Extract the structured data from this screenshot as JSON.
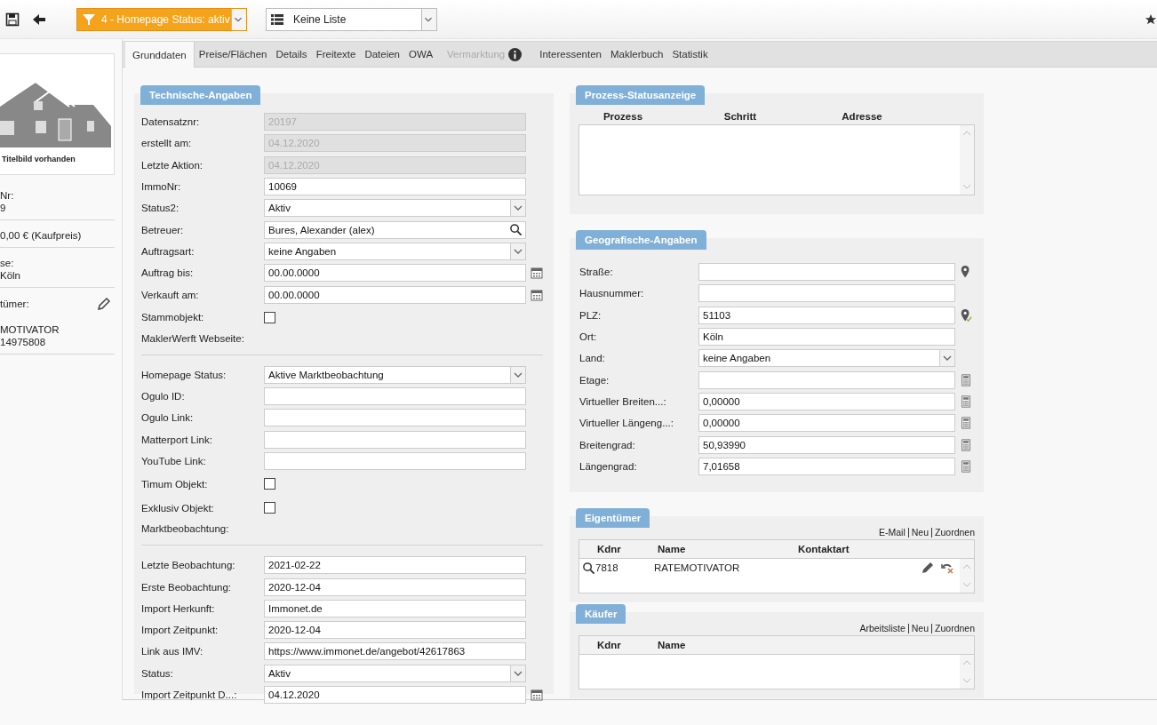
{
  "toolbar": {
    "filter": "4 - Homepage Status: aktiv",
    "list": "Keine Liste"
  },
  "sidebar": {
    "image_caption": "Titelbild vorhanden",
    "items": [
      {
        "label": "Nr:",
        "value": "9",
        "editable": false
      },
      {
        "value": "0,00 € (Kaufpreis)",
        "editable": false
      },
      {
        "label": "se:",
        "value": "Köln",
        "editable": false
      },
      {
        "label": "tümer:",
        "value": "MOTIVATOR",
        "extra": "14975808",
        "editable": true
      }
    ]
  },
  "tabs": [
    {
      "label": "Grunddaten",
      "selected": true,
      "disabled": false
    },
    {
      "label": "Preise/Flächen",
      "selected": false,
      "disabled": false
    },
    {
      "label": "Details",
      "selected": false,
      "disabled": false
    },
    {
      "label": "Freitexte",
      "selected": false,
      "disabled": false
    },
    {
      "label": "Dateien",
      "selected": false,
      "disabled": false
    },
    {
      "label": "OWA",
      "selected": false,
      "disabled": false
    },
    {
      "label": "Vermarktung",
      "selected": false,
      "disabled": true,
      "info": true
    },
    {
      "label": "Interessenten",
      "selected": false,
      "disabled": false
    },
    {
      "label": "Maklerbuch",
      "selected": false,
      "disabled": false
    },
    {
      "label": "Statistik",
      "selected": false,
      "disabled": false
    }
  ],
  "technical": {
    "title": "Technische-Angaben",
    "groups": [
      [
        {
          "label": "Datensatznr:",
          "kind": "text",
          "value": "20197",
          "disabled": true
        },
        {
          "label": "erstellt am:",
          "kind": "text",
          "value": "04.12.2020",
          "disabled": true
        },
        {
          "label": "Letzte Aktion:",
          "kind": "text",
          "value": "04.12.2020",
          "disabled": true
        },
        {
          "label": "ImmoNr:",
          "kind": "text",
          "value": "10069",
          "disabled": false
        },
        {
          "label": "Status2:",
          "kind": "select",
          "value": "Aktiv",
          "disabled": false
        },
        {
          "label": "Betreuer:",
          "kind": "search",
          "value": "Bures, Alexander (alex)",
          "disabled": false
        },
        {
          "label": "Auftragsart:",
          "kind": "select",
          "value": "keine Angaben",
          "disabled": false
        },
        {
          "label": "Auftrag bis:",
          "kind": "date",
          "value": "00.00.0000",
          "disabled": false
        },
        {
          "label": "Verkauft am:",
          "kind": "date",
          "value": "00.00.0000",
          "disabled": false
        },
        {
          "label": "Stammobjekt:",
          "kind": "checkbox",
          "checked": false,
          "disabled": false
        },
        {
          "label": "MaklerWerft Webseite:",
          "kind": "note"
        }
      ],
      [
        {
          "label": "Homepage Status:",
          "kind": "select",
          "value": "Aktive Marktbeobachtung",
          "disabled": false
        },
        {
          "label": "Ogulo ID:",
          "kind": "text",
          "disabled": false
        },
        {
          "label": "Ogulo Link:",
          "kind": "text",
          "disabled": false
        },
        {
          "label": "Matterport Link:",
          "kind": "text",
          "disabled": false
        },
        {
          "label": "YouTube Link:",
          "kind": "text",
          "disabled": false
        },
        {
          "label": "Timum Objekt:",
          "kind": "checkbox",
          "checked": false,
          "disabled": false
        },
        {
          "label": "Exklusiv Objekt:",
          "kind": "checkbox",
          "checked": false,
          "disabled": false
        },
        {
          "label": "Marktbeobachtung:",
          "kind": "note"
        }
      ],
      [
        {
          "label": "Letzte Beobachtung:",
          "kind": "text",
          "value": "2021-02-22",
          "disabled": false
        },
        {
          "label": "Erste Beobachtung:",
          "kind": "text",
          "value": "2020-12-04",
          "disabled": false
        },
        {
          "label": "Import Herkunft:",
          "kind": "text",
          "value": "Immonet.de",
          "disabled": false
        },
        {
          "label": "Import Zeitpunkt:",
          "kind": "text",
          "value": "2020-12-04",
          "disabled": false
        },
        {
          "label": "Link aus IMV:",
          "kind": "text",
          "value": "https://www.immonet.de/angebot/42617863",
          "disabled": false
        },
        {
          "label": "Status:",
          "kind": "select",
          "value": "Aktiv",
          "disabled": false
        },
        {
          "label": "Import Zeitpunkt D...:",
          "kind": "date",
          "value": "04.12.2020",
          "disabled": false
        }
      ]
    ]
  },
  "process": {
    "title": "Prozess-Statusanzeige",
    "columns": [
      "Prozess",
      "Schritt",
      "Adresse"
    ]
  },
  "geo": {
    "title": "Geografische-Angaben",
    "fields": [
      {
        "label": "Straße:",
        "kind": "text",
        "map_pin": true
      },
      {
        "label": "Hausnummer:",
        "kind": "text"
      },
      {
        "label": "PLZ:",
        "kind": "text",
        "value": "51103",
        "map_pin": true,
        "pin_checked": true
      },
      {
        "label": "Ort:",
        "kind": "text",
        "value": "Köln"
      },
      {
        "label": "Land:",
        "kind": "select",
        "value": "keine Angaben"
      },
      {
        "label": "Etage:",
        "kind": "text",
        "calculator": true
      },
      {
        "label": "Virtueller Breiten...:",
        "kind": "text",
        "value": "0,00000",
        "calculator": true
      },
      {
        "label": "Virtueller Längeng...:",
        "kind": "text",
        "value": "0,00000",
        "calculator": true
      },
      {
        "label": "Breitengrad:",
        "kind": "text",
        "value": "50,93990",
        "calculator": true
      },
      {
        "label": "Längengrad:",
        "kind": "text",
        "value": "7,01658",
        "calculator": true
      }
    ]
  },
  "owners": {
    "title": "Eigentümer",
    "links": [
      "E-Mail",
      "Neu",
      "Zuordnen"
    ],
    "columns": [
      "Kdnr",
      "Name",
      "Kontaktart"
    ],
    "rows": [
      {
        "kdnr": "7818",
        "name": "RATEMOTIVATOR"
      }
    ]
  },
  "buyers": {
    "title": "Käufer",
    "links": [
      "Arbeitsliste",
      "Neu",
      "Zuordnen"
    ],
    "columns": [
      "Kdnr",
      "Name"
    ]
  }
}
